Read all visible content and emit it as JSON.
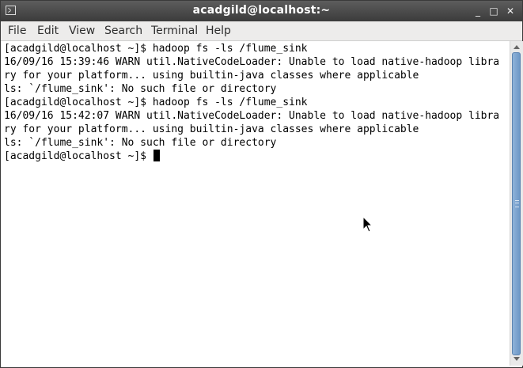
{
  "window": {
    "title": "acadgild@localhost:~"
  },
  "controls": {
    "minimize": "_",
    "maximize": "□",
    "close": "✕"
  },
  "menu": [
    "File",
    "Edit",
    "View",
    "Search",
    "Terminal",
    "Help"
  ],
  "terminal": {
    "lines": [
      "[acadgild@localhost ~]$ hadoop fs -ls /flume_sink",
      "16/09/16 15:39:46 WARN util.NativeCodeLoader: Unable to load native-hadoop libra",
      "ry for your platform... using builtin-java classes where applicable",
      "ls: `/flume_sink': No such file or directory",
      "[acadgild@localhost ~]$ hadoop fs -ls /flume_sink",
      "16/09/16 15:42:07 WARN util.NativeCodeLoader: Unable to load native-hadoop libra",
      "ry for your platform... using builtin-java classes where applicable",
      "ls: `/flume_sink': No such file or directory",
      "[acadgild@localhost ~]$ "
    ]
  },
  "icons": {
    "app": "terminal-icon",
    "minimize": "minimize-icon",
    "maximize": "maximize-icon",
    "close": "close-icon",
    "pointer": "mouse-pointer-icon"
  },
  "colors": {
    "titlebar": "#4a4a4a",
    "menubar": "#edeceb",
    "terminal_bg": "#ffffff",
    "terminal_fg": "#000000",
    "scroll_thumb": "#7aa3cf"
  }
}
